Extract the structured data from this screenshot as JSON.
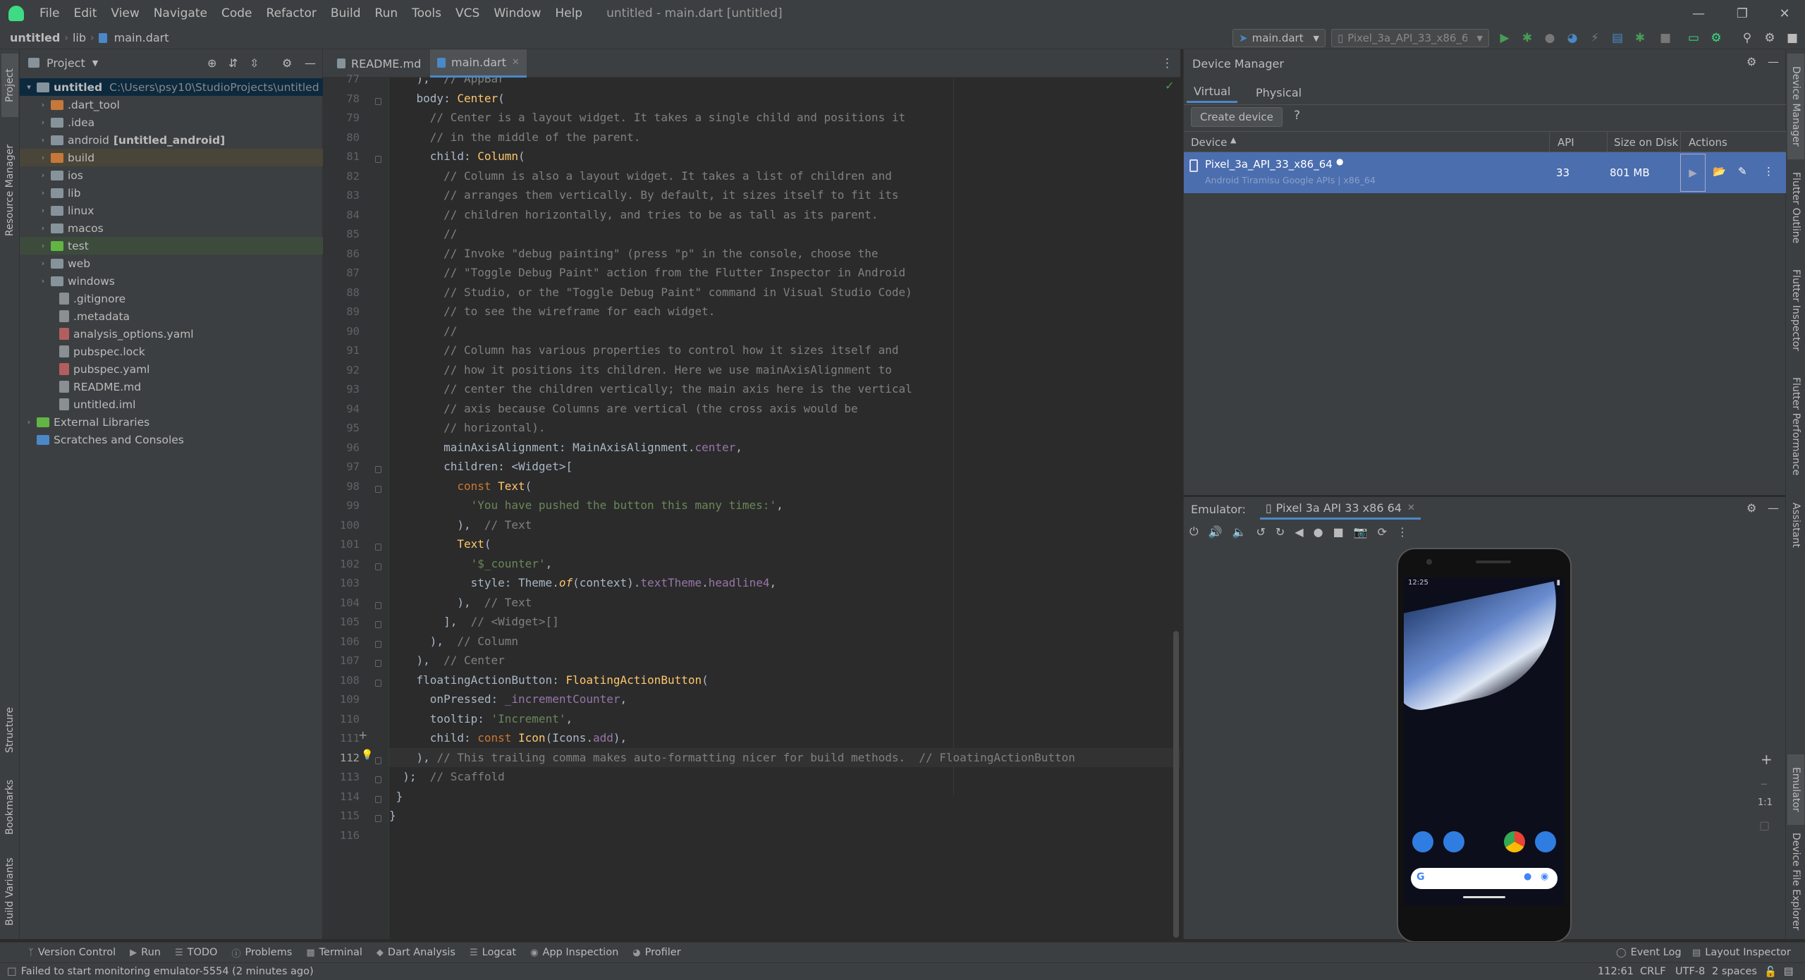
{
  "menu": {
    "items": [
      "File",
      "Edit",
      "View",
      "Navigate",
      "Code",
      "Refactor",
      "Build",
      "Run",
      "Tools",
      "VCS",
      "Window",
      "Help"
    ],
    "window_title": "untitled - main.dart [untitled]"
  },
  "breadcrumb": {
    "project": "untitled",
    "folder": "lib",
    "file": "main.dart"
  },
  "toolbar": {
    "run_config": "main.dart",
    "device": "Pixel_3a_API_33_x86_64"
  },
  "project_panel": {
    "title": "Project",
    "tree": [
      {
        "label": "untitled",
        "extra": "C:\\Users\\psy10\\StudioProjects\\untitled",
        "type": "root"
      },
      {
        "label": ".dart_tool",
        "type": "folder-orange"
      },
      {
        "label": ".idea",
        "type": "folder"
      },
      {
        "label": "android",
        "extra": "[untitled_android]",
        "type": "folder"
      },
      {
        "label": "build",
        "type": "folder-orange"
      },
      {
        "label": "ios",
        "type": "folder"
      },
      {
        "label": "lib",
        "type": "folder"
      },
      {
        "label": "linux",
        "type": "folder"
      },
      {
        "label": "macos",
        "type": "folder"
      },
      {
        "label": "test",
        "type": "folder-green"
      },
      {
        "label": "web",
        "type": "folder"
      },
      {
        "label": "windows",
        "type": "folder"
      },
      {
        "label": ".gitignore",
        "type": "file"
      },
      {
        "label": ".metadata",
        "type": "file"
      },
      {
        "label": "analysis_options.yaml",
        "type": "file-yaml"
      },
      {
        "label": "pubspec.lock",
        "type": "file"
      },
      {
        "label": "pubspec.yaml",
        "type": "file-yaml"
      },
      {
        "label": "README.md",
        "type": "file"
      },
      {
        "label": "untitled.iml",
        "type": "file"
      },
      {
        "label": "External Libraries",
        "type": "lib"
      },
      {
        "label": "Scratches and Consoles",
        "type": "scratch"
      }
    ]
  },
  "editor": {
    "tabs": [
      "README.md",
      "main.dart"
    ],
    "line_numbers": [
      "77",
      "78",
      "79",
      "80",
      "81",
      "82",
      "83",
      "84",
      "85",
      "86",
      "87",
      "88",
      "89",
      "90",
      "91",
      "92",
      "93",
      "94",
      "95",
      "96",
      "97",
      "98",
      "99",
      "100",
      "101",
      "102",
      "103",
      "104",
      "105",
      "106",
      "107",
      "108",
      "109",
      "110",
      "111",
      "112",
      "113",
      "114",
      "115",
      "116"
    ],
    "current_line": "112"
  },
  "device_manager": {
    "title": "Device Manager",
    "tabs": [
      "Virtual",
      "Physical"
    ],
    "create_button": "Create device",
    "help": "?",
    "columns": [
      "Device",
      "API",
      "Size on Disk",
      "Actions"
    ],
    "device": {
      "name": "Pixel_3a_API_33_x86_64",
      "subtitle": "Android Tiramisu Google APIs | x86_64",
      "api": "33",
      "size": "801 MB"
    }
  },
  "emulator": {
    "label": "Emulator:",
    "tab": "Pixel 3a API 33 x86 64",
    "clock": "12:25",
    "zoom_fit": "1:1"
  },
  "bottom_tools": [
    "Version Control",
    "Run",
    "TODO",
    "Problems",
    "Terminal",
    "Dart Analysis",
    "Logcat",
    "App Inspection",
    "Profiler"
  ],
  "bottom_right_tools": [
    "Event Log",
    "Layout Inspector"
  ],
  "status": {
    "message": "Failed to start monitoring emulator-5554 (2 minutes ago)",
    "position": "112:61",
    "line_sep": "CRLF",
    "encoding": "UTF-8",
    "indent": "2 spaces"
  },
  "left_strip": [
    "Project",
    "Resource Manager",
    "Structure",
    "Bookmarks",
    "Build Variants"
  ],
  "right_strip": [
    "Device Manager",
    "Flutter Outline",
    "Flutter Inspector",
    "Flutter Performance",
    "Assistant",
    "Emulator",
    "Device File Explorer"
  ],
  "colors": {
    "accent": "#4a88c7",
    "selection": "#4b6eaf",
    "run_green": "#499c54",
    "bg": "#2b2b2b",
    "panel": "#3c3f41"
  }
}
